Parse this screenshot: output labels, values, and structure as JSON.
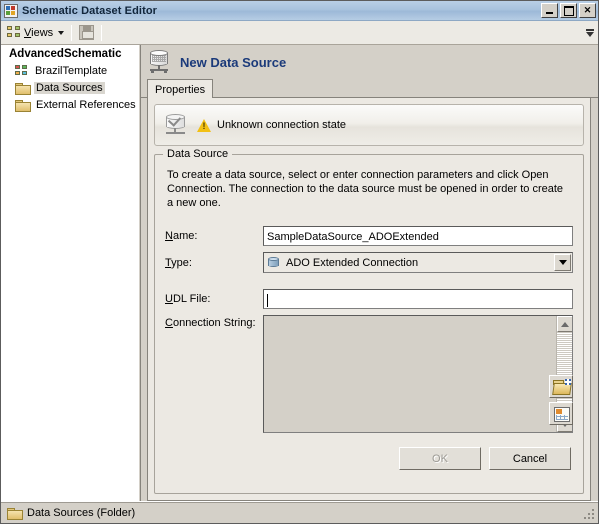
{
  "window": {
    "title": "Schematic Dataset Editor",
    "icon": "schematic-app-icon",
    "min_label": "",
    "max_label": "",
    "close_label": ""
  },
  "toolbar": {
    "views_label": "Views",
    "views_icon": "views-icon",
    "views_dropdown_icon": "chevron-down-icon",
    "save_icon": "save-icon",
    "overflow_icon": "toolbar-overflow-icon"
  },
  "tree": {
    "root": "AdvancedSchematic",
    "items": [
      {
        "label": "BrazilTemplate",
        "icon": "schematic-icon",
        "selected": false
      },
      {
        "label": "Data Sources",
        "icon": "folder-icon",
        "selected": true
      },
      {
        "label": "External References",
        "icon": "folder-icon",
        "selected": false
      }
    ]
  },
  "document": {
    "icon": "data-source-icon",
    "title": "New Data Source"
  },
  "tabs": [
    {
      "label": "Properties",
      "active": true
    }
  ],
  "banner": {
    "icon": "data-source-state-icon",
    "warning_icon": "warning-icon",
    "text": "Unknown connection state"
  },
  "group": {
    "title": "Data Source",
    "description": "To create a data source, select or enter connection parameters and click Open Connection.  The connection to the data source must be opened in order to create a new one.",
    "fields": {
      "name": {
        "label": "Name:",
        "accesskey": "N",
        "value": "SampleDataSource_ADOExtended",
        "placeholder": ""
      },
      "type": {
        "label": "Type:",
        "accesskey": "T",
        "value": "ADO Extended Connection",
        "icon": "connection-type-icon",
        "dropdown_icon": "chevron-down-icon",
        "options": [
          "ADO Extended Connection"
        ]
      },
      "udl_file": {
        "label": "UDL File:",
        "accesskey": "U",
        "value": "",
        "placeholder": "",
        "browse_icon": "open-folder-icon"
      },
      "connection_string": {
        "label": "Connection String:",
        "accesskey": "C",
        "value": "",
        "placeholder": "",
        "builder_icon": "properties-grid-icon",
        "scroll_up_icon": "scroll-up-icon",
        "scroll_down_icon": "scroll-down-icon"
      }
    }
  },
  "buttons": {
    "ok": {
      "label": "OK",
      "enabled": false
    },
    "cancel": {
      "label": "Cancel",
      "enabled": true
    }
  },
  "statusbar": {
    "icon": "folder-icon",
    "text": "Data Sources (Folder)",
    "grip_icon": "resize-grip-icon"
  },
  "colors": {
    "title_accent": "#1b3a7a",
    "window_face": "#d4d0c8",
    "tab_page": "#ece9e3",
    "warning": "#f2c014"
  }
}
